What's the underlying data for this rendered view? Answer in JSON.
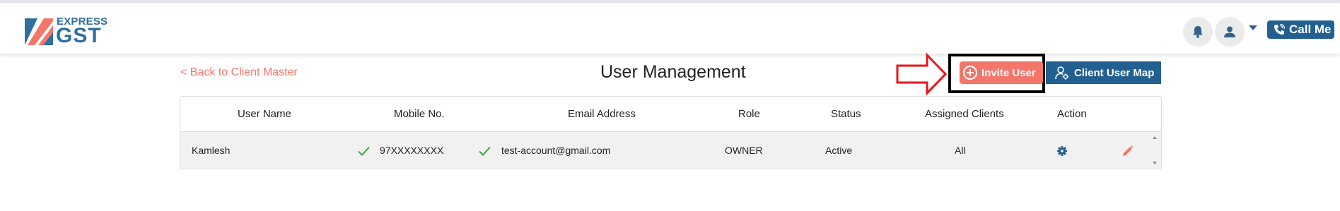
{
  "app": {
    "logo_line1": "EXPRESS",
    "logo_line2": "GST"
  },
  "header": {
    "bell_icon": "bell-icon",
    "user_icon": "user-icon",
    "call_me_label": "Call Me"
  },
  "page": {
    "back_link": "< Back to Client Master",
    "title": "User Management",
    "invite_button": "Invite User",
    "client_user_map_button": "Client User Map"
  },
  "table": {
    "columns": [
      "User Name",
      "Mobile No.",
      "Email Address",
      "Role",
      "Status",
      "Assigned Clients",
      "Action"
    ],
    "rows": [
      {
        "user_name": "Kamlesh",
        "mobile": "97XXXXXXXX",
        "mobile_verified": true,
        "email": "test-account@gmail.com",
        "email_verified": true,
        "role": "OWNER",
        "status": "Active",
        "assigned_clients": "All"
      }
    ]
  },
  "colors": {
    "brand_blue": "#236091",
    "accent_salmon": "#f3766a",
    "verified_green": "#3aa83a",
    "annotation_red": "#e8141c"
  }
}
